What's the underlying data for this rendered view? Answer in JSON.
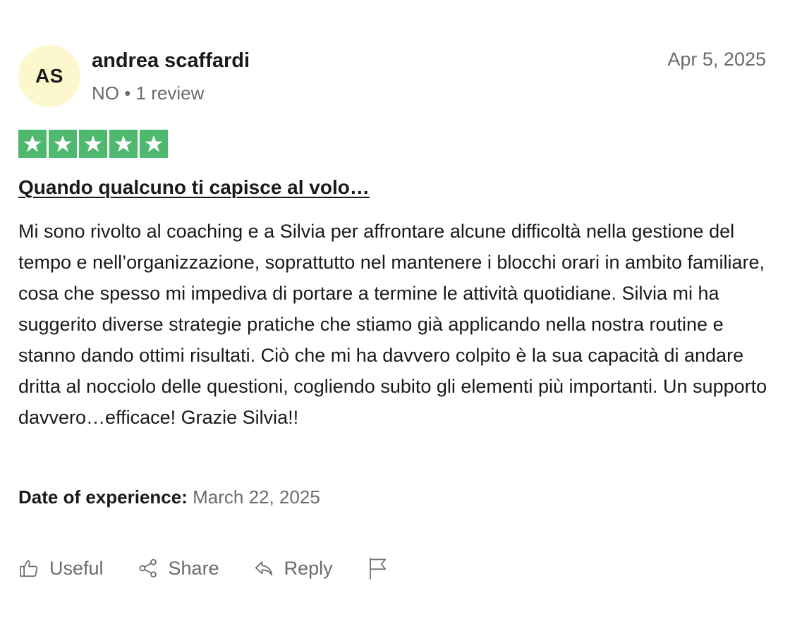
{
  "reviewer": {
    "initials": "AS",
    "name": "andrea scaffardi",
    "meta": "NO • 1 review",
    "avatar_color": "#fcf7cc"
  },
  "review": {
    "date": "Apr 5, 2025",
    "rating": 5,
    "rating_color": "#4fb86f",
    "title": "Quando qualcuno ti capisce al volo…",
    "body": "Mi sono rivolto al coaching e a Silvia per affrontare alcune difficoltà nella gestione del tempo e nell’organizzazione, soprattutto nel mantenere i blocchi orari in ambito familiare, cosa che spesso mi impediva di portare a termine le attività quotidiane. Silvia mi ha suggerito diverse strategie pratiche che stiamo già applicando nella nostra routine e stanno dando ottimi risultati. Ciò che mi ha davvero colpito è la sua capacità di andare dritta al nocciolo delle questioni, cogliendo subito gli elementi più importanti. Un supporto davvero…efficace! Grazie Silvia!!",
    "experience_label": "Date of experience:",
    "experience_date": "March 22, 2025"
  },
  "actions": {
    "useful": {
      "label": "Useful",
      "icon": "thumbs-up-icon"
    },
    "share": {
      "label": "Share",
      "icon": "share-icon"
    },
    "reply": {
      "label": "Reply",
      "icon": "reply-arrow-icon"
    },
    "report": {
      "icon": "flag-icon"
    }
  }
}
